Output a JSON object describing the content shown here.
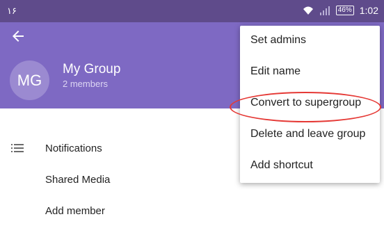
{
  "status": {
    "left_text": "۱۶",
    "battery": "46%",
    "time": "1:02"
  },
  "header": {
    "avatar_initials": "MG",
    "title": "My Group",
    "subtitle": "2 members"
  },
  "list": {
    "items": [
      {
        "label": "Notifications"
      },
      {
        "label": "Shared Media"
      },
      {
        "label": "Add member"
      }
    ]
  },
  "menu": {
    "items": [
      {
        "label": "Set admins"
      },
      {
        "label": "Edit name"
      },
      {
        "label": "Convert to supergroup"
      },
      {
        "label": "Delete and leave group"
      },
      {
        "label": "Add shortcut"
      }
    ]
  }
}
